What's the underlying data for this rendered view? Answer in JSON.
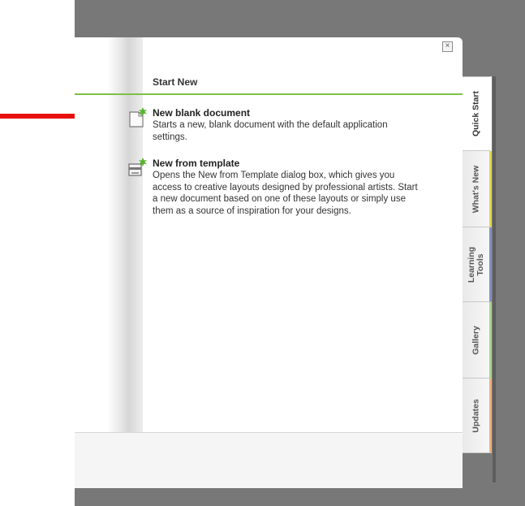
{
  "window": {
    "close_glyph": "×"
  },
  "start_new": {
    "title": "Start New",
    "items": [
      {
        "icon": "new-blank-document-icon",
        "title": "New blank document",
        "description": "Starts a new, blank document with the default application settings."
      },
      {
        "icon": "new-from-template-icon",
        "title": "New from template",
        "description": "Opens the New from Template dialog box, which gives you access to creative layouts designed by professional artists. Start a new document based on one of these layouts or simply use them as a source of inspiration for your designs."
      }
    ]
  },
  "tabs": [
    {
      "label": "Quick Start",
      "active": true,
      "accent": "#ffffff"
    },
    {
      "label": "What's New",
      "active": false,
      "accent": "#e2d84c"
    },
    {
      "label": "Learning Tools",
      "active": false,
      "accent": "#7f8fc4"
    },
    {
      "label": "Gallery",
      "active": false,
      "accent": "#a9d58c"
    },
    {
      "label": "Updates",
      "active": false,
      "accent": "#f0b07a"
    }
  ],
  "colors": {
    "accent_green": "#7cc146",
    "pointer_arrow": "#e8100f",
    "backdrop": "#787878"
  }
}
